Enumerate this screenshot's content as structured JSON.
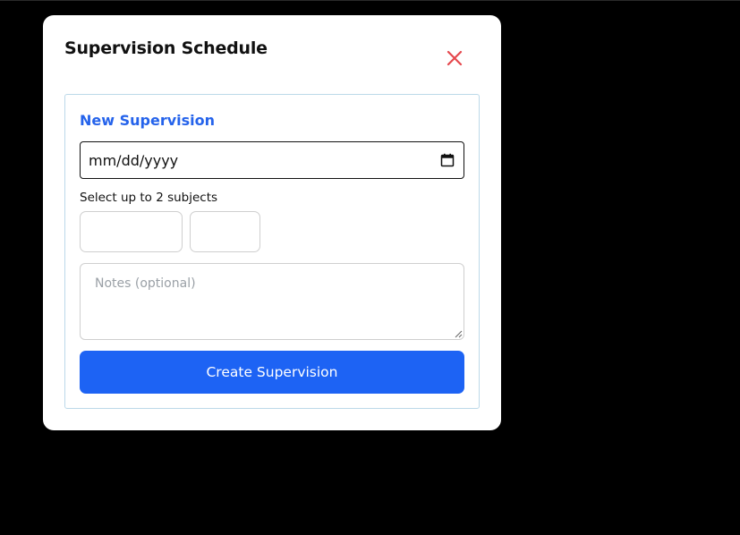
{
  "modal": {
    "title": "Supervision Schedule",
    "close_icon": "close-icon",
    "close_color": "#e5484d"
  },
  "form": {
    "heading": "New Supervision",
    "heading_color": "#2563eb",
    "date": {
      "value": "mm/dd/yyyy",
      "icon": "calendar-icon"
    },
    "subjects": {
      "label": "Select up to 2 subjects",
      "options": [
        "",
        ""
      ]
    },
    "notes": {
      "placeholder": "Notes (optional)",
      "value": ""
    },
    "submit": {
      "label": "Create Supervision",
      "color": "#1d63f4"
    }
  }
}
